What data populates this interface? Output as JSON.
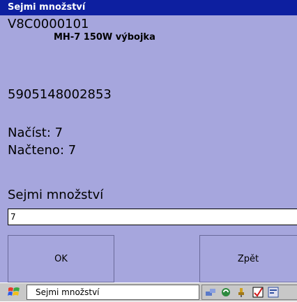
{
  "window": {
    "title": "Sejmi množství"
  },
  "item": {
    "code": "V8C0000101",
    "description": "MH-7 150W výbojka",
    "barcode": "5905148002853"
  },
  "counts": {
    "to_read": "Načíst: 7",
    "read": "Načteno: 7"
  },
  "quantity": {
    "label": "Sejmi množství",
    "value": "7"
  },
  "buttons": {
    "ok": "OK",
    "back": "Zpět"
  },
  "taskbar": {
    "active_task": "Sejmi množství",
    "tray_icons": [
      "network-icon",
      "sync-icon",
      "power-icon",
      "checkbox-icon",
      "app-icon"
    ]
  },
  "colors": {
    "title_bar": "#0d1fa0",
    "background": "#a6a6dd"
  }
}
